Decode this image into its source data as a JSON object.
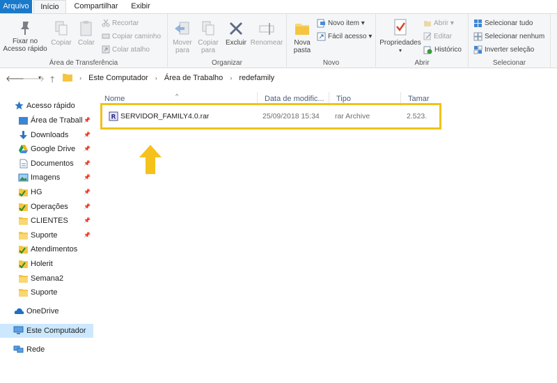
{
  "ribbon_tabs": [
    "Arquivo",
    "Início",
    "Compartilhar",
    "Exibir"
  ],
  "groups": {
    "clipboard": {
      "label": "Área de Transferência",
      "pin": "Fixar no Acesso rápido",
      "copy": "Copiar",
      "paste": "Colar",
      "cut": "Recortar",
      "copy_path": "Copiar caminho",
      "paste_shortcut": "Colar atalho"
    },
    "organize": {
      "label": "Organizar",
      "move_to": "Mover para",
      "copy_to": "Copiar para",
      "delete": "Excluir",
      "rename": "Renomear"
    },
    "new": {
      "label": "Novo",
      "new_folder": "Nova pasta",
      "new_item": "Novo item",
      "easy_access": "Fácil acesso"
    },
    "open": {
      "label": "Abrir",
      "properties": "Propriedades",
      "open": "Abrir",
      "edit": "Editar",
      "history": "Histórico"
    },
    "select": {
      "label": "Selecionar",
      "select_all": "Selecionar tudo",
      "select_none": "Selecionar nenhum",
      "invert": "Inverter seleção"
    }
  },
  "breadcrumb": [
    "Este Computador",
    "Área de Trabalho",
    "redefamily"
  ],
  "nav": {
    "quick_access": "Acesso rápido",
    "pinned": [
      {
        "label": "Área de Trabalho",
        "icon": "desktop-icon"
      },
      {
        "label": "Downloads",
        "icon": "download-icon"
      },
      {
        "label": "Google Drive",
        "icon": "google-drive-icon"
      },
      {
        "label": "Documentos",
        "icon": "documents-icon"
      },
      {
        "label": "Imagens",
        "icon": "pictures-icon"
      },
      {
        "label": "HG",
        "icon": "folder-check-icon"
      },
      {
        "label": "Operações",
        "icon": "folder-check-icon"
      },
      {
        "label": "CLIENTES",
        "icon": "folder-icon"
      },
      {
        "label": "Suporte",
        "icon": "folder-icon"
      }
    ],
    "recent": [
      {
        "label": "Atendimentos",
        "icon": "folder-check-icon"
      },
      {
        "label": "Holerit",
        "icon": "folder-check-icon"
      },
      {
        "label": "Semana2",
        "icon": "folder-icon"
      },
      {
        "label": "Suporte",
        "icon": "folder-icon"
      }
    ],
    "onedrive": "OneDrive",
    "this_pc": "Este Computador",
    "network": "Rede"
  },
  "columns": [
    "Nome",
    "Data de modific...",
    "Tipo",
    "Tamar"
  ],
  "files": [
    {
      "name": "SERVIDOR_FAMILY4.0.rar",
      "modified": "25/09/2018 15:34",
      "type": "rar Archive",
      "size": "2.523.("
    }
  ],
  "colors": {
    "highlight_border": "#f0c21b",
    "arrow": "#f5c21b",
    "accent": "#1979ca",
    "selection": "#cce8ff"
  }
}
